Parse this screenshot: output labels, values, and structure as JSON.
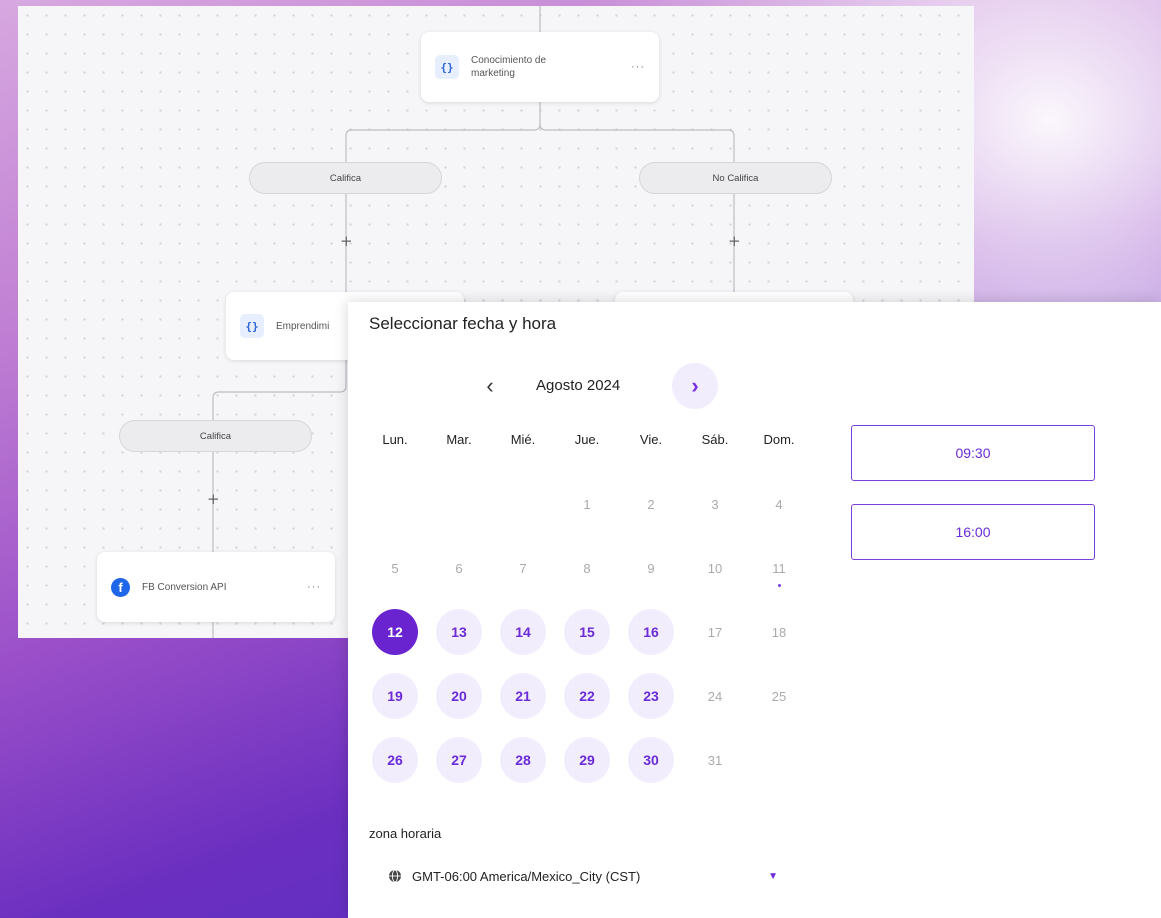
{
  "flow": {
    "root_node": {
      "label_line1": "Conocimiento de",
      "label_line2": "marketing",
      "icon": "braces-icon",
      "more": "···"
    },
    "branch_left": {
      "label": "Califica"
    },
    "branch_right": {
      "label": "No Califica"
    },
    "node_left": {
      "label": "Emprendimi",
      "icon": "braces-icon"
    },
    "branch_left2": {
      "label": "Califica"
    },
    "fb_node": {
      "label": "FB Conversion API",
      "icon": "facebook-icon",
      "more": "···"
    },
    "plus": "+"
  },
  "picker": {
    "title": "Seleccionar fecha y hora",
    "month": "Agosto 2024",
    "prev": "‹",
    "next": "›",
    "weekdays": [
      "Lun.",
      "Mar.",
      "Mié.",
      "Jue.",
      "Vie.",
      "Sáb.",
      "Dom."
    ],
    "weeks": [
      [
        "",
        "",
        "",
        "1",
        "2",
        "3",
        "4"
      ],
      [
        "5",
        "6",
        "7",
        "8",
        "9",
        "10",
        "11"
      ],
      [
        "12",
        "13",
        "14",
        "15",
        "16",
        "17",
        "18"
      ],
      [
        "19",
        "20",
        "21",
        "22",
        "23",
        "24",
        "25"
      ],
      [
        "26",
        "27",
        "28",
        "29",
        "30",
        "31",
        ""
      ]
    ],
    "available_days": [
      "12",
      "13",
      "14",
      "15",
      "16",
      "19",
      "20",
      "21",
      "22",
      "23",
      "26",
      "27",
      "28",
      "29",
      "30"
    ],
    "selected_day": "12",
    "today": "11",
    "time_slots": [
      "09:30",
      "16:00"
    ],
    "timezone_label": "zona horaria",
    "timezone_value": "GMT-06:00 America/Mexico_City (CST)"
  },
  "colors": {
    "accent": "#6a24cf",
    "available_bg": "#f1edfd",
    "node_icon_blue": "#2f63d8",
    "facebook_blue": "#1f66e8"
  }
}
